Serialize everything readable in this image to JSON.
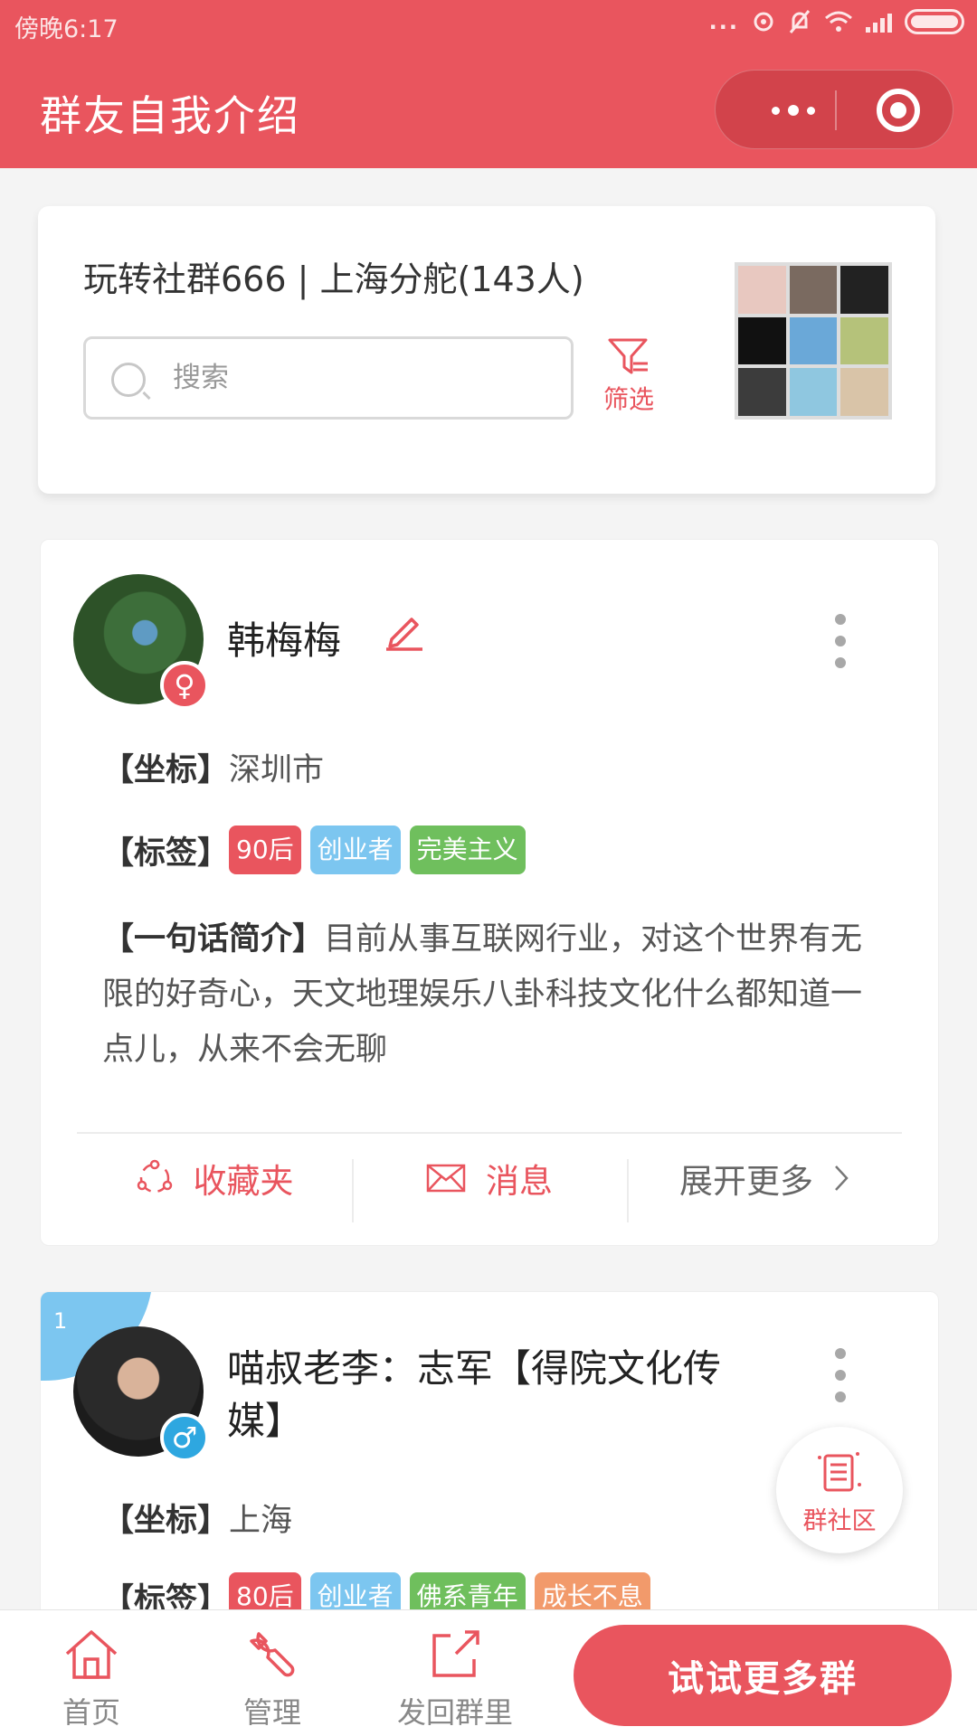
{
  "status_bar": {
    "time": "傍晚6:17",
    "dots": "...",
    "icons": [
      "sync-icon",
      "mute-icon",
      "wifi-icon",
      "signal-icon",
      "battery-icon"
    ]
  },
  "header": {
    "title": "群友自我介绍"
  },
  "group": {
    "name": "玩转社群666 | 上海分舵(143人)",
    "search_placeholder": "搜索",
    "filter_label": "筛选"
  },
  "members": [
    {
      "name": "韩梅梅",
      "gender": "♀",
      "location_label": "【坐标】",
      "location": "深圳市",
      "tags_label": "【标签】",
      "tags": [
        "90后",
        "创业者",
        "完美主义"
      ],
      "intro_label": "【一句话简介】",
      "intro": "目前从事互联网行业，对这个世界有无限的好奇心，天文地理娱乐八卦科技文化什么都知道一点儿，从来不会无聊",
      "actions": {
        "favorites": "收藏夹",
        "message": "消息",
        "expand": "展开更多"
      }
    },
    {
      "rank": "1",
      "name": "喵叔老李：志军【得院文化传媒】",
      "gender": "♂",
      "location_label": "【坐标】",
      "location": "上海",
      "tags_label": "【标签】",
      "tags": [
        "80后",
        "创业者",
        "佛系青年",
        "成长不息"
      ]
    }
  ],
  "floating_button": {
    "label": "群社区"
  },
  "bottom_nav": {
    "home": "首页",
    "manage": "管理",
    "share_back": "发回群里",
    "cta": "试试更多群"
  },
  "colors": {
    "brand": "#e9555e",
    "tag_red": "#e9555e",
    "tag_blue": "#7cc6f0",
    "tag_green": "#6fbf5d",
    "tag_orange": "#f29a6b"
  }
}
